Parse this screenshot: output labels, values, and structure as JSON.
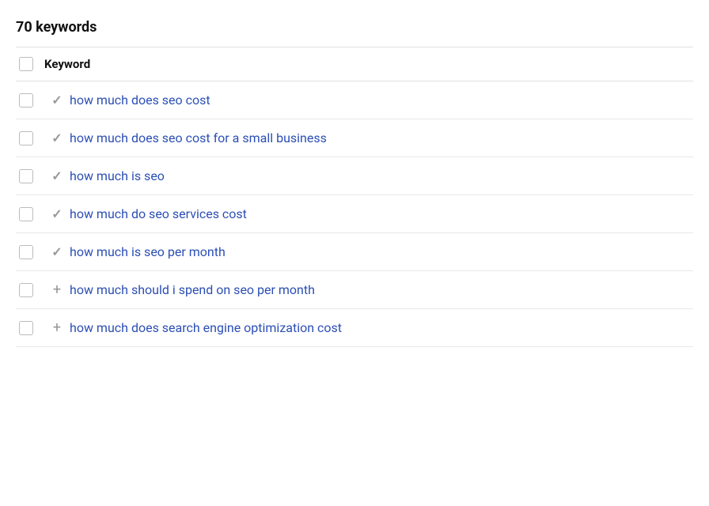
{
  "header": {
    "keyword_count": "70 keywords",
    "column_label": "Keyword"
  },
  "keywords": [
    {
      "id": 1,
      "text": "how much does seo cost",
      "icon": "check"
    },
    {
      "id": 2,
      "text": "how much does seo cost for a small business",
      "icon": "check"
    },
    {
      "id": 3,
      "text": "how much is seo",
      "icon": "check"
    },
    {
      "id": 4,
      "text": "how much do seo services cost",
      "icon": "check"
    },
    {
      "id": 5,
      "text": "how much is seo per month",
      "icon": "check"
    },
    {
      "id": 6,
      "text": "how much should i spend on seo per month",
      "icon": "plus"
    },
    {
      "id": 7,
      "text": "how much does search engine optimization cost",
      "icon": "plus"
    }
  ],
  "icons": {
    "check": "✓",
    "plus": "+"
  }
}
